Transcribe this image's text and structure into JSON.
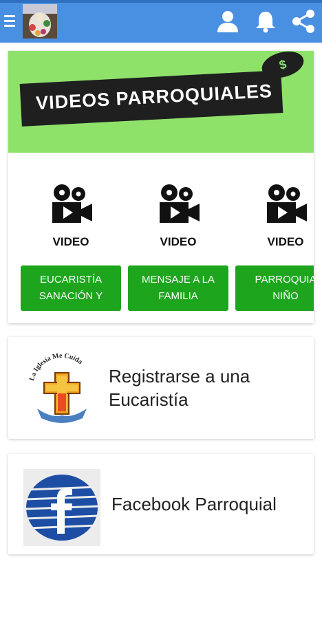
{
  "topbar": {
    "color": "#4a90e2",
    "menu_icon": "hamburger-menu-icon",
    "profile_icon": "user-icon",
    "notifications_icon": "bell-icon",
    "share_icon": "share-icon"
  },
  "banner": {
    "title": "VIDEOS PARROQUIALES",
    "badge": "$",
    "color": "#8ee26a"
  },
  "videos": [
    {
      "caption": "VIDEO",
      "button_label": "EUCARISTÍA\nSANACIÓN Y"
    },
    {
      "caption": "VIDEO",
      "button_label": "MENSAJE A LA\nFAMILIA"
    },
    {
      "caption": "VIDEO",
      "button_label": "PARROQUIA\nNIÑO"
    }
  ],
  "links": [
    {
      "label": "Registrarse a una\nEucaristía",
      "logo_text": "La Iglesia Me Cuida"
    },
    {
      "label": "Facebook Parroquial"
    }
  ],
  "accent_green": "#1ea51e"
}
